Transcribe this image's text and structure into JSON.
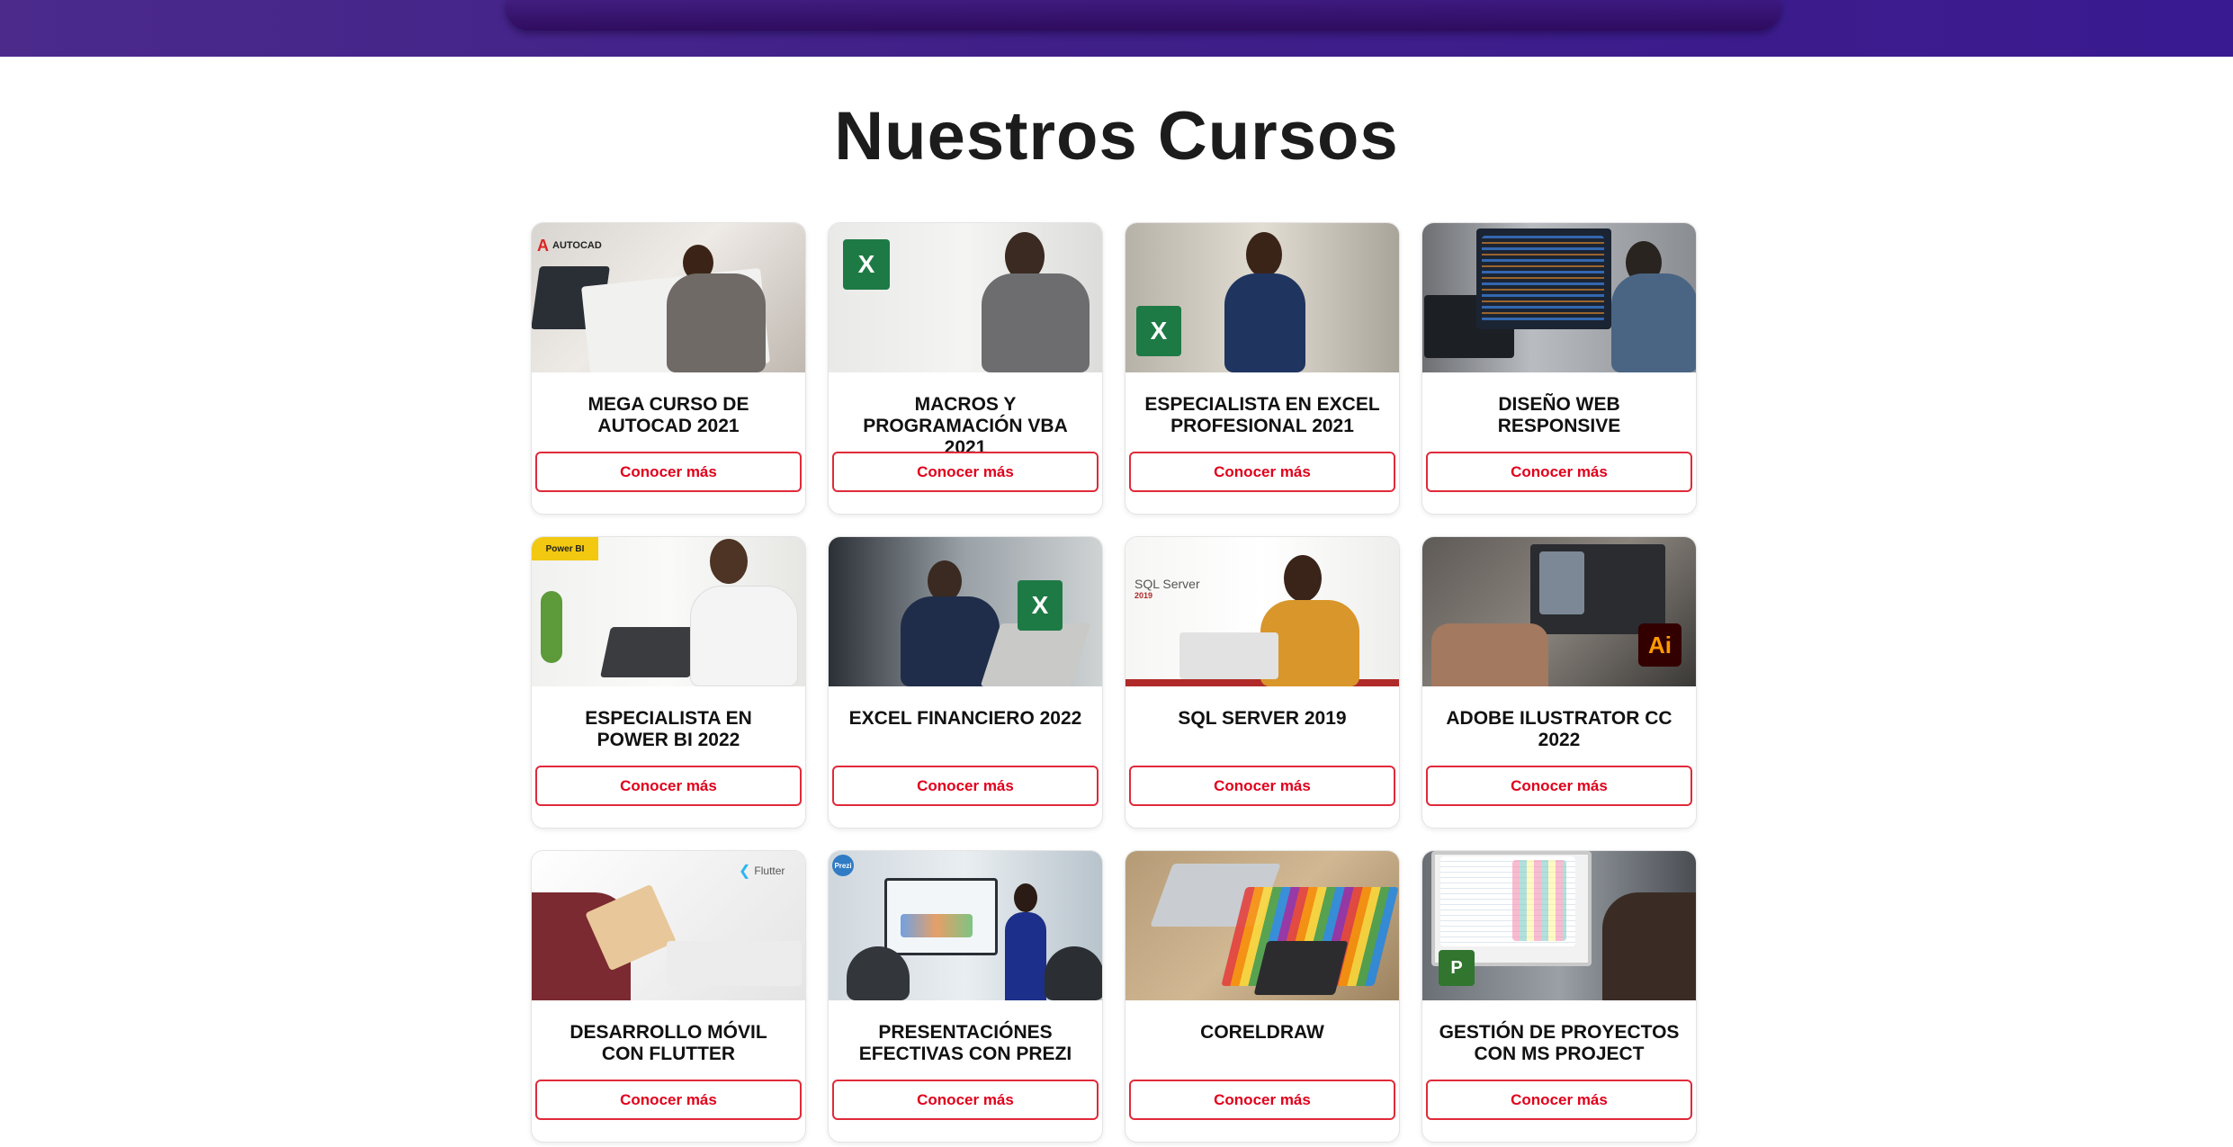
{
  "section": {
    "title": "Nuestros Cursos"
  },
  "courses": [
    {
      "title": "MEGA CURSO DE AUTOCAD 2021",
      "cta": "Conocer más",
      "badge": "AUTOCAD",
      "icon": "autocad-logo-icon"
    },
    {
      "title": "MACROS Y PROGRAMACIÓN VBA 2021",
      "cta": "Conocer más",
      "badge": "X",
      "icon": "excel-logo-icon"
    },
    {
      "title": "ESPECIALISTA EN EXCEL PROFESIONAL 2021",
      "cta": "Conocer más",
      "badge": "X",
      "icon": "excel-logo-icon"
    },
    {
      "title": "DISEÑO WEB RESPONSIVE",
      "cta": "Conocer más",
      "badge": "",
      "icon": ""
    },
    {
      "title": "ESPECIALISTA EN POWER BI 2022",
      "cta": "Conocer más",
      "badge": "Power BI",
      "icon": "power-bi-logo-icon"
    },
    {
      "title": "EXCEL FINANCIERO 2022",
      "cta": "Conocer más",
      "badge": "X",
      "icon": "excel-logo-icon"
    },
    {
      "title": "SQL SERVER 2019",
      "cta": "Conocer más",
      "badge": "SQL Server",
      "badge_sub": "2019",
      "icon": "sql-server-logo-icon"
    },
    {
      "title": "ADOBE ILUSTRATOR CC 2022",
      "cta": "Conocer más",
      "badge": "Ai",
      "icon": "illustrator-logo-icon"
    },
    {
      "title": "DESARROLLO MÓVIL CON FLUTTER",
      "cta": "Conocer más",
      "badge": "Flutter",
      "icon": "flutter-logo-icon"
    },
    {
      "title": "PRESENTACIÓNES EFECTIVAS CON PREZI",
      "cta": "Conocer más",
      "badge": "Prezi",
      "icon": "prezi-logo-icon"
    },
    {
      "title": "CORELDRAW",
      "cta": "Conocer más",
      "badge": "",
      "icon": ""
    },
    {
      "title": "GESTIÓN DE PROYECTOS CON MS PROJECT",
      "cta": "Conocer más",
      "badge": "P",
      "icon": "ms-project-logo-icon"
    }
  ],
  "colors": {
    "header_gradient": "#3f1f88",
    "cta_border": "#e02a3a",
    "cta_text": "#e0001b",
    "title_text": "#1c1c1c"
  }
}
